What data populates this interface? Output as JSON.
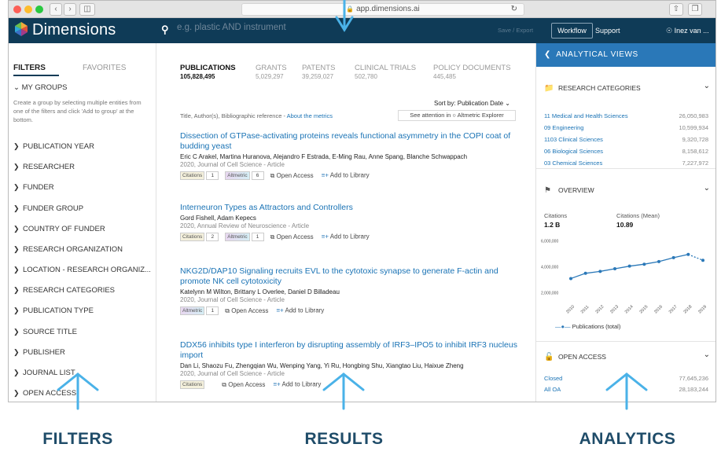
{
  "browser": {
    "url": "app.dimensions.ai"
  },
  "app": {
    "logo": "Dimensions",
    "search_placeholder": "e.g. plastic AND instrument",
    "save_export": "Save / Export",
    "workflow": "Workflow",
    "support": "Support",
    "user": "Inez van ..."
  },
  "filters": {
    "tab_filters": "FILTERS",
    "tab_favorites": "FAVORITES",
    "my_groups": "MY GROUPS",
    "my_groups_desc": "Create a group by selecting multiple entities from one of the filters and click 'Add to group' at the bottom.",
    "items": [
      "PUBLICATION YEAR",
      "RESEARCHER",
      "FUNDER",
      "FUNDER GROUP",
      "COUNTRY OF FUNDER",
      "RESEARCH ORGANIZATION",
      "LOCATION - RESEARCH ORGANIZ...",
      "RESEARCH CATEGORIES",
      "PUBLICATION TYPE",
      "SOURCE TITLE",
      "PUBLISHER",
      "JOURNAL LIST",
      "OPEN ACCESS"
    ]
  },
  "results": {
    "tabs": [
      {
        "label": "PUBLICATIONS",
        "count": "105,828,495"
      },
      {
        "label": "GRANTS",
        "count": "5,029,297"
      },
      {
        "label": "PATENTS",
        "count": "39,259,027"
      },
      {
        "label": "CLINICAL TRIALS",
        "count": "502,780"
      },
      {
        "label": "POLICY DOCUMENTS",
        "count": "445,485"
      }
    ],
    "sort_label": "Sort by: Publication Date",
    "meta_prefix": "Title, Author(s), Bibliographic reference - ",
    "meta_link": "About the metrics",
    "attention": "See attention in ○ Altmetric Explorer",
    "citations_label": "Citations",
    "altmetric_label": "Altmetric",
    "open_access": "Open Access",
    "add_library": "Add to Library",
    "items": [
      {
        "title": "Dissection of GTPase-activating proteins reveals functional asymmetry in the COPI coat of budding yeast",
        "authors": "Eric C Arakel, Martina Huranova, Alejandro F Estrada, E-Ming Rau, Anne Spang, Blanche Schwappach",
        "journal": "2020, Journal of Cell Science - Article",
        "citations": "1",
        "altmetric": "6"
      },
      {
        "title": "Interneuron Types as Attractors and Controllers",
        "authors": "Gord Fishell, Adam Kepecs",
        "journal": "2020, Annual Review of Neuroscience - Article",
        "citations": "2",
        "altmetric": "1"
      },
      {
        "title": "NKG2D/DAP10 Signaling recruits EVL to the cytotoxic synapse to generate F-actin and promote NK cell cytotoxicity",
        "authors": "Katelynn M Wilton, Brittany L Overlee, Daniel D Billadeau",
        "journal": "2020, Journal of Cell Science - Article",
        "citations": "",
        "altmetric": "1"
      },
      {
        "title": "DDX56 inhibits type I interferon by disrupting assembly of IRF3–IPO5 to inhibit IRF3 nucleus import",
        "authors": "Dan Li, Shaozu Fu, Zhengqian Wu, Wenping Yang, Yi Ru, Hongbing Shu, Xiangtao Liu, Haixue Zheng",
        "journal": "2020, Journal of Cell Science - Article",
        "citations": "",
        "altmetric": ""
      }
    ]
  },
  "analytics": {
    "header": "ANALYTICAL VIEWS",
    "research_categories": "RESEARCH CATEGORIES",
    "categories": [
      {
        "label": "11 Medical and Health Sciences",
        "value": "26,050,983"
      },
      {
        "label": "09 Engineering",
        "value": "10,599,934"
      },
      {
        "label": "1103 Clinical Sciences",
        "value": "9,320,728"
      },
      {
        "label": "06 Biological Sciences",
        "value": "8,158,612"
      },
      {
        "label": "03 Chemical Sciences",
        "value": "7,227,972"
      }
    ],
    "overview": "OVERVIEW",
    "citations_label": "Citations",
    "citations_value": "1.2 B",
    "citations_mean_label": "Citations (Mean)",
    "citations_mean_value": "10.89",
    "open_access": "OPEN ACCESS",
    "oa_rows": [
      {
        "label": "Closed",
        "value": "77,645,236"
      },
      {
        "label": "All OA",
        "value": "28,183,244"
      }
    ]
  },
  "chart_data": {
    "type": "line",
    "x": [
      "2010",
      "2011",
      "2012",
      "2013",
      "2014",
      "2015",
      "2016",
      "2017",
      "2018",
      "2019"
    ],
    "series": [
      {
        "name": "Publications (total)",
        "values": [
          3100000,
          3500000,
          3650000,
          3850000,
          4050000,
          4200000,
          4400000,
          4700000,
          4950000,
          4500000
        ]
      }
    ],
    "yticks": [
      "6,000,000",
      "4,000,000",
      "2,000,000"
    ],
    "ylim": [
      1500000,
      6200000
    ],
    "color": "#2a78b8"
  },
  "captions": {
    "filters": "FILTERS",
    "results": "RESULTS",
    "analytics": "ANALYTICS"
  }
}
